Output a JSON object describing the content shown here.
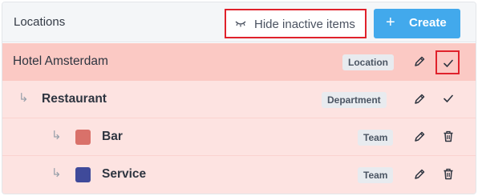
{
  "header": {
    "title": "Locations",
    "hide_inactive_label": "Hide inactive items",
    "create_label": "Create",
    "create_icon": "+"
  },
  "rows": [
    {
      "name": "Hotel Amsterdam",
      "type": "Location",
      "level": 0,
      "color": null,
      "actions": [
        "edit",
        "check"
      ]
    },
    {
      "name": "Restaurant",
      "type": "Department",
      "level": 1,
      "color": null,
      "actions": [
        "edit",
        "check"
      ]
    },
    {
      "name": "Bar",
      "type": "Team",
      "level": 2,
      "color": "#d9716a",
      "actions": [
        "edit",
        "delete"
      ]
    },
    {
      "name": "Service",
      "type": "Team",
      "level": 2,
      "color": "#3f4a9a",
      "actions": [
        "edit",
        "delete"
      ]
    }
  ],
  "icons": {
    "indent": "↳",
    "edit": "pencil-icon",
    "check": "check-icon",
    "delete": "trash-icon",
    "hide": "closed-eye-icon"
  },
  "colors": {
    "accent": "#42a9ec",
    "highlight_border": "#e0212b",
    "location_row": "#fbc9c4",
    "child_row": "#fde3e1"
  }
}
